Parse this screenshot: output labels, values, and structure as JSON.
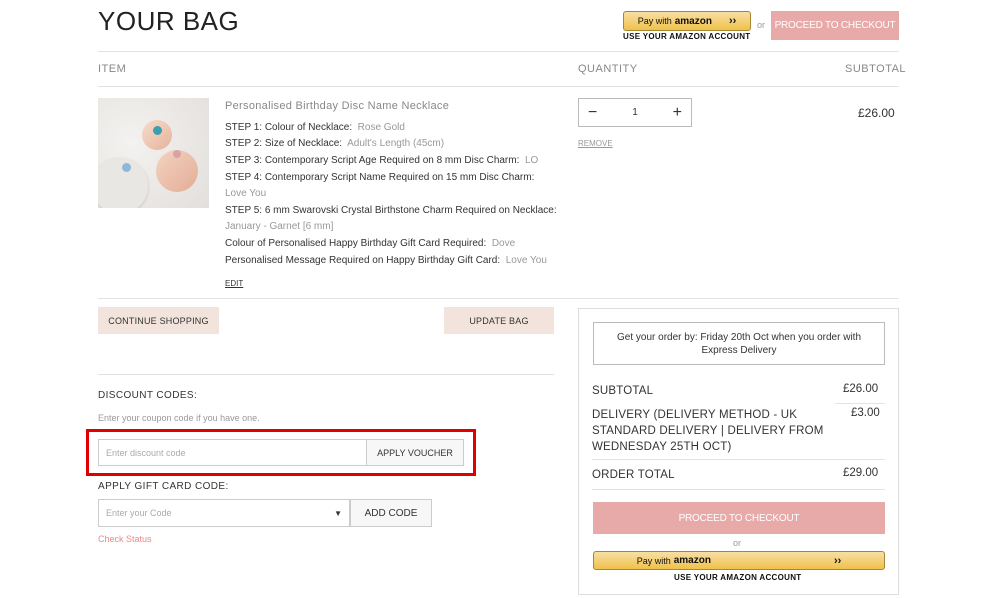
{
  "page": {
    "title": "YOUR BAG"
  },
  "header": {
    "amazon_pay_prefix": "Pay with",
    "amazon_pay_brand": "amazon",
    "amazon_caption": "USE YOUR AMAZON ACCOUNT",
    "or_text": "or",
    "checkout_label": "PROCEED TO CHECKOUT"
  },
  "columns": {
    "item": "ITEM",
    "quantity": "QUANTITY",
    "subtotal": "SUBTOTAL"
  },
  "product": {
    "name": "Personalised Birthday Disc Name Necklace",
    "steps": [
      {
        "label": "STEP 1: Colour of Necklace:",
        "value": "Rose Gold"
      },
      {
        "label": "STEP 2: Size of Necklace:",
        "value": "Adult's Length (45cm)"
      },
      {
        "label": "STEP 3: Contemporary Script Age Required on 8 mm Disc Charm:",
        "value": "LO"
      },
      {
        "label": "STEP 4: Contemporary Script Name Required on 15 mm Disc Charm:",
        "value": ""
      },
      {
        "label": "",
        "value": "Love You"
      },
      {
        "label": "STEP 5: 6 mm Swarovski Crystal Birthstone Charm Required on Necklace:",
        "value": ""
      },
      {
        "label": "",
        "value": "January - Garnet [6 mm]"
      },
      {
        "label": "Colour of Personalised Happy Birthday Gift Card Required:",
        "value": "Dove"
      },
      {
        "label": "Personalised Message Required on Happy Birthday Gift Card:",
        "value": "Love You"
      }
    ],
    "edit_label": "EDIT",
    "quantity": "1",
    "minus": "−",
    "plus": "+",
    "remove_label": "REMOVE",
    "price": "£26.00"
  },
  "actions": {
    "continue_shopping": "CONTINUE SHOPPING",
    "update_bag": "UPDATE BAG"
  },
  "discount": {
    "heading": "DISCOUNT CODES:",
    "hint": "Enter your coupon code if you have one.",
    "placeholder": "Enter discount code",
    "apply_label": "APPLY VOUCHER"
  },
  "gift_card": {
    "heading": "APPLY GIFT CARD CODE:",
    "placeholder": "Enter your Code",
    "add_label": "ADD CODE",
    "check_status": "Check Status"
  },
  "summary": {
    "delivery_notice": "Get your order by: Friday 20th Oct when you order with Express Delivery",
    "subtotal_label": "SUBTOTAL",
    "subtotal_value": "£26.00",
    "delivery_label": "DELIVERY (DELIVERY METHOD - UK STANDARD DELIVERY | DELIVERY FROM WEDNESDAY 25TH OCT)",
    "delivery_value": "£3.00",
    "total_label": "ORDER TOTAL",
    "total_value": "£29.00",
    "checkout_label": "PROCEED TO CHECKOUT",
    "or_text": "or",
    "amazon_pay_prefix": "Pay with",
    "amazon_pay_brand": "amazon",
    "amazon_caption": "USE YOUR AMAZON ACCOUNT"
  },
  "colors": {
    "checkout_pink": "#e8a9a9",
    "beige_button": "#f2e4dc",
    "highlight_red": "#e00000",
    "amazon_gold": "#f0c14b",
    "check_status": "#e88a8a"
  }
}
